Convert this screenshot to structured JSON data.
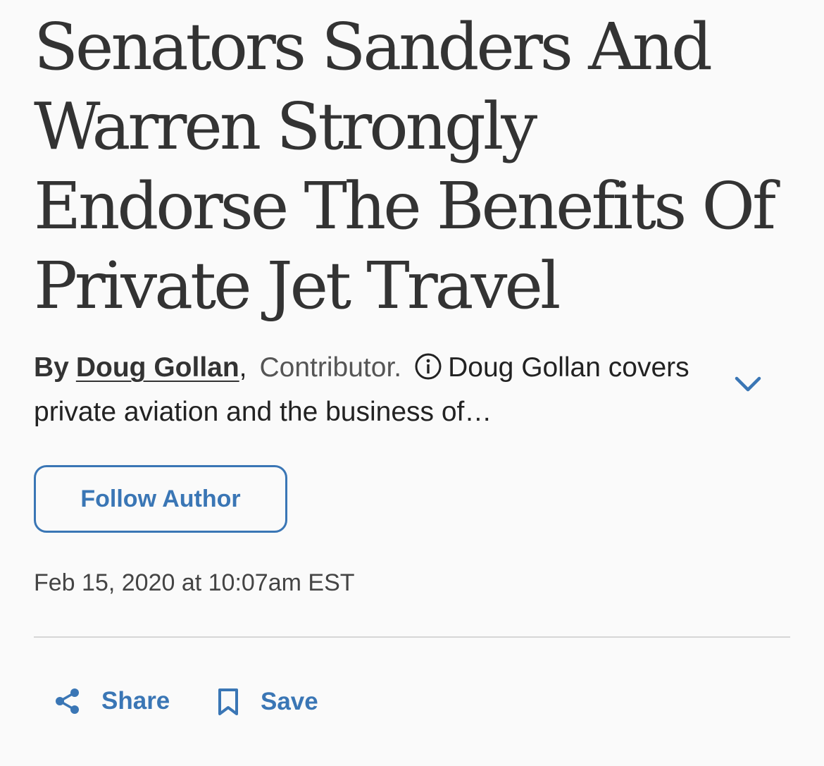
{
  "article": {
    "headline": "Senators Sanders And Warren Strongly Endorse The Benefits Of Private Jet Travel",
    "byline": {
      "by_label": "By",
      "author_name": "Doug Gollan",
      "separator": ",",
      "role": "Contributor.",
      "bio_teaser": "Doug Gollan covers private aviation and the business of…"
    },
    "follow_label": "Follow Author",
    "timestamp": "Feb 15, 2020 at 10:07am EST"
  },
  "actions": {
    "share_label": "Share",
    "save_label": "Save"
  },
  "icons": {
    "info": "info-icon",
    "expand": "chevron-down-icon",
    "share": "share-icon",
    "save": "bookmark-icon"
  },
  "colors": {
    "text": "#333333",
    "accent": "#3a76b5",
    "divider": "#d6d6d6",
    "background": "#fafafa"
  }
}
